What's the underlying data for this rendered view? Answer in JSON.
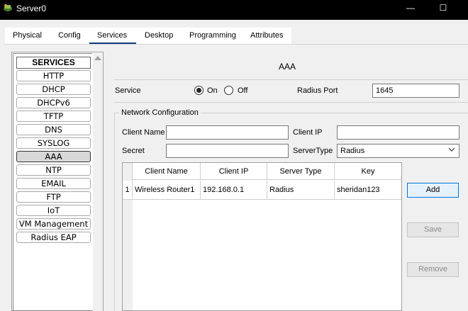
{
  "window": {
    "title": "Server0",
    "minimize_glyph": "—",
    "maximize_glyph": "☐"
  },
  "tabs": [
    {
      "label": "Physical"
    },
    {
      "label": "Config"
    },
    {
      "label": "Services"
    },
    {
      "label": "Desktop"
    },
    {
      "label": "Programming"
    },
    {
      "label": "Attributes"
    }
  ],
  "active_tab": "Services",
  "services": {
    "header": "SERVICES",
    "items": [
      "HTTP",
      "DHCP",
      "DHCPv6",
      "TFTP",
      "DNS",
      "SYSLOG",
      "AAA",
      "NTP",
      "EMAIL",
      "FTP",
      "IoT",
      "VM Management",
      "Radius EAP"
    ],
    "selected": "AAA"
  },
  "aaa": {
    "title": "AAA",
    "service_label": "Service",
    "on_label": "On",
    "off_label": "Off",
    "service_state": "On",
    "radius_port_label": "Radius Port",
    "radius_port_value": "1645",
    "group_title": "Network Configuration",
    "client_name_label": "Client Name",
    "client_name_value": "",
    "client_ip_label": "Client IP",
    "client_ip_value": "",
    "secret_label": "Secret",
    "secret_value": "",
    "server_type_label": "ServerType",
    "server_type_value": "Radius",
    "table": {
      "columns": [
        "Client Name",
        "Client IP",
        "Server Type",
        "Key"
      ],
      "rows": [
        {
          "num": "1",
          "client_name": "Wireless Router1",
          "client_ip": "192.168.0.1",
          "server_type": "Radius",
          "key": "sheridan123"
        }
      ]
    },
    "buttons": {
      "add": "Add",
      "save": "Save",
      "remove": "Remove"
    }
  }
}
